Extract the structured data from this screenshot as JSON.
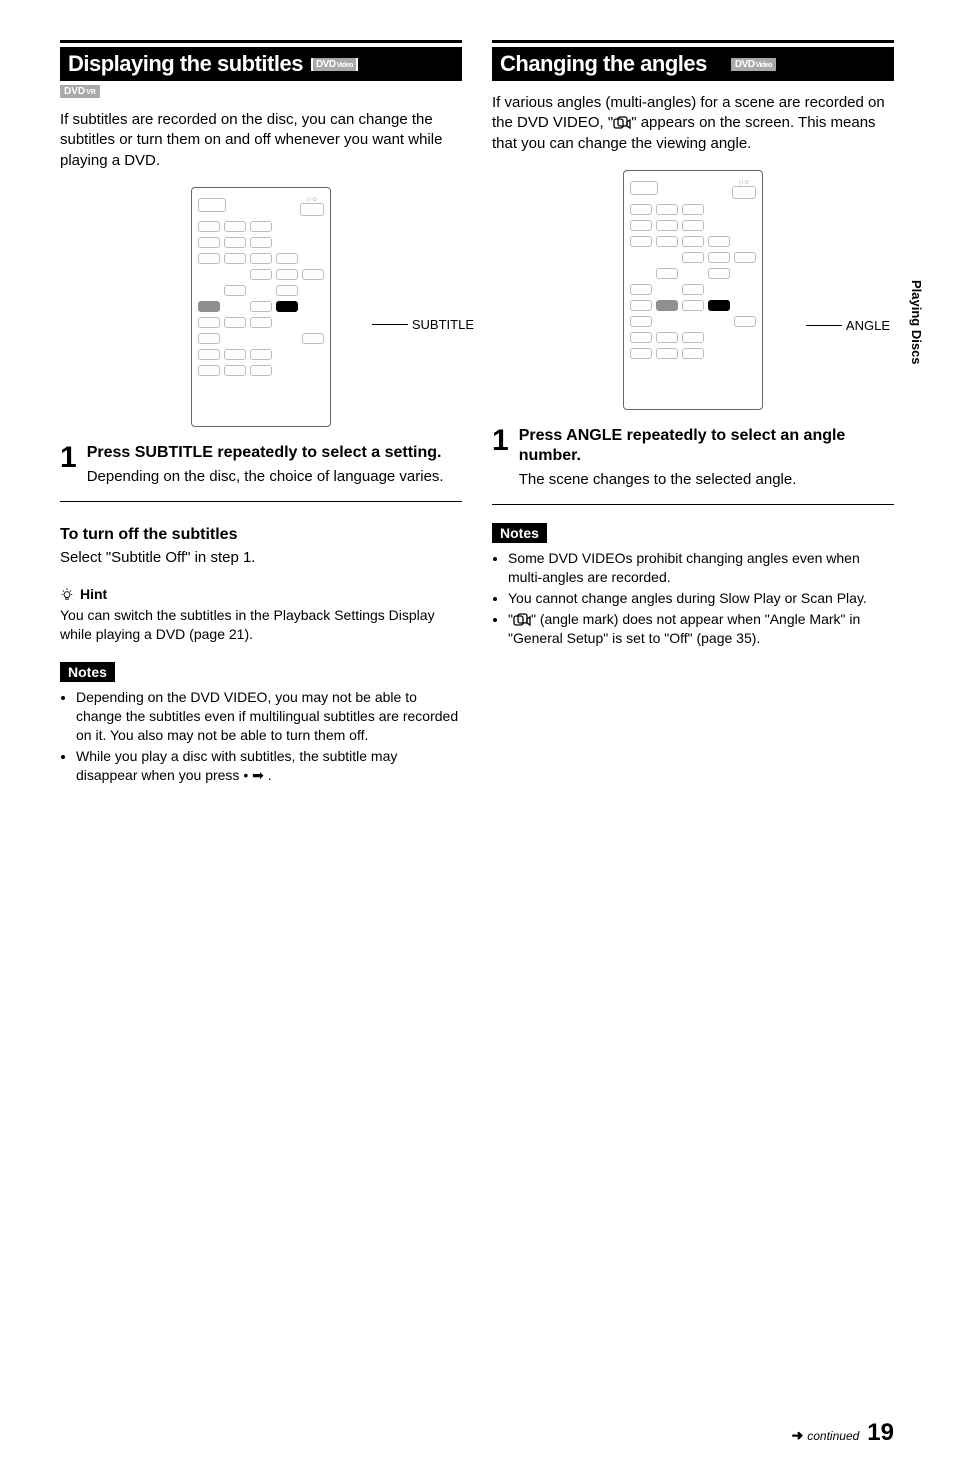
{
  "sidebar_label": "Playing Discs",
  "left": {
    "title": "Displaying the subtitles",
    "title_tags": [
      {
        "main": "DVD",
        "sub": "Video"
      },
      {
        "main": "DVD",
        "sub": "VR"
      }
    ],
    "intro": "If subtitles are recorded on the disc, you can change the subtitles or turn them on and off whenever you want while playing a DVD.",
    "remote_callout": "SUBTITLE",
    "step": {
      "num": "1",
      "title": "Press SUBTITLE repeatedly to select a setting.",
      "body": "Depending on the disc, the choice of language varies."
    },
    "subheading": "To turn off the subtitles",
    "subheading_body": "Select \"Subtitle Off\" in step 1.",
    "hint_label": "Hint",
    "hint_body": "You can switch the subtitles in the Playback Settings Display while playing a DVD (page 21).",
    "notes_label": "Notes",
    "notes": [
      "Depending on the DVD VIDEO, you may not be able to change the subtitles even if multilingual subtitles are recorded on it. You also may not be able to turn them off.",
      "While you play a disc with subtitles, the subtitle may disappear when you press • ➡ ."
    ]
  },
  "right": {
    "title": "Changing the angles",
    "title_tags": [
      {
        "main": "DVD",
        "sub": "Video"
      }
    ],
    "intro_pre": "If various angles (multi-angles) for a scene are recorded on the DVD VIDEO, \"",
    "intro_post": "\" appears on the screen. This means that you can change the viewing angle.",
    "remote_callout": "ANGLE",
    "step": {
      "num": "1",
      "title": "Press ANGLE repeatedly to select an angle number.",
      "body": "The scene changes to the selected angle."
    },
    "notes_label": "Notes",
    "notes": [
      "Some DVD VIDEOs prohibit changing angles even when multi-angles are recorded.",
      "You cannot change angles during Slow Play or Scan Play."
    ],
    "note3_pre": "\"",
    "note3_mid": "\" (angle mark) does not appear when \"Angle Mark\" in \"General Setup\" is set to \"Off\" (page 35)."
  },
  "footer": {
    "continued": "continued",
    "page": "19"
  }
}
